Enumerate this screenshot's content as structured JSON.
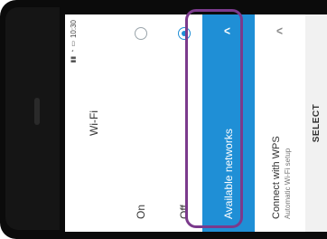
{
  "status": {
    "time": "10:30",
    "icons": [
      "signal-icon",
      "wifi-icon",
      "battery-icon"
    ]
  },
  "title": "Wi-Fi",
  "options": {
    "on_label": "On",
    "off_label": "Off",
    "selected": "Off"
  },
  "networks": {
    "label": "Available networks"
  },
  "wps": {
    "title": "Connect with WPS",
    "subtitle": "Automatic Wi-Fi setup"
  },
  "select_label": "SELECT",
  "colors": {
    "accent": "#1f8fd6",
    "highlight": "#7b3a8c"
  }
}
